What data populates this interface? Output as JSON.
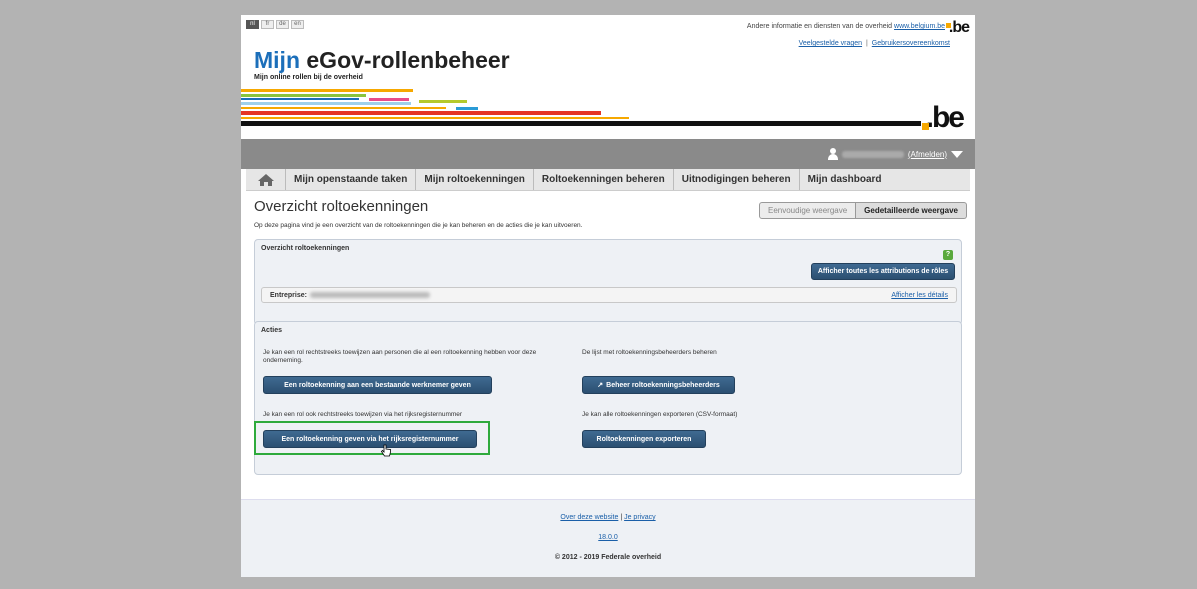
{
  "languages": [
    "nl",
    "fr",
    "de",
    "en"
  ],
  "top": {
    "info_text": "Andere informatie en diensten van de overheid",
    "info_link": "www.belgium.be",
    "be_logo": ".be",
    "faq_link": "Veelgestelde vragen",
    "separator": "|",
    "terms_link": "Gebruikersovereenkomst"
  },
  "header": {
    "title_mijn": "Mijn",
    "title_rest": " eGov-rollenbeheer",
    "subtitle": "Mijn online rollen bij de overheid",
    "big_be": ".be"
  },
  "userbar": {
    "logout": "(Afmelden)"
  },
  "nav": {
    "items": [
      "Mijn openstaande taken",
      "Mijn roltoekenningen",
      "Roltoekenningen beheren",
      "Uitnodigingen beheren",
      "Mijn dashboard"
    ]
  },
  "main": {
    "page_title": "Overzicht roltoekenningen",
    "intro": "Op deze pagina vind je een overzicht van de roltoekenningen die je kan beheren en de acties die je kan uitvoeren.",
    "view_simple": "Eenvoudige weergave",
    "view_detailed": "Gedetailleerde weergave"
  },
  "overview": {
    "title": "Overzicht roltoekenningen",
    "help": "?",
    "show_all_button": "Afficher toutes les attributions de rôles",
    "enterprise_label": "Entreprise:",
    "details_link": "Afficher les détails"
  },
  "actions": {
    "title": "Acties",
    "text1": "Je kan een rol rechtstreeks toewijzen aan personen die al een roltoekenning hebben voor deze onderneming.",
    "button1": "Een roltoekenning aan een bestaande werknemer geven",
    "text2": "De lijst met roltoekenningsbeheerders beheren",
    "button2": "Beheer roltoekenningsbeheerders",
    "text3": "Je kan een rol ook rechtstreeks toewijzen via het rijksregisternummer",
    "button3": "Een roltoekenning geven via het rijksregisternummer",
    "text4": "Je kan alle roltoekenningen exporteren (CSV-formaat)",
    "button4": "Roltoekenningen exporteren"
  },
  "footer": {
    "about_link": "Over deze website",
    "separator": "|",
    "privacy_link": "Je privacy",
    "version": "18.0.0",
    "copyright": "© 2012 - 2019 Federale overheid"
  }
}
